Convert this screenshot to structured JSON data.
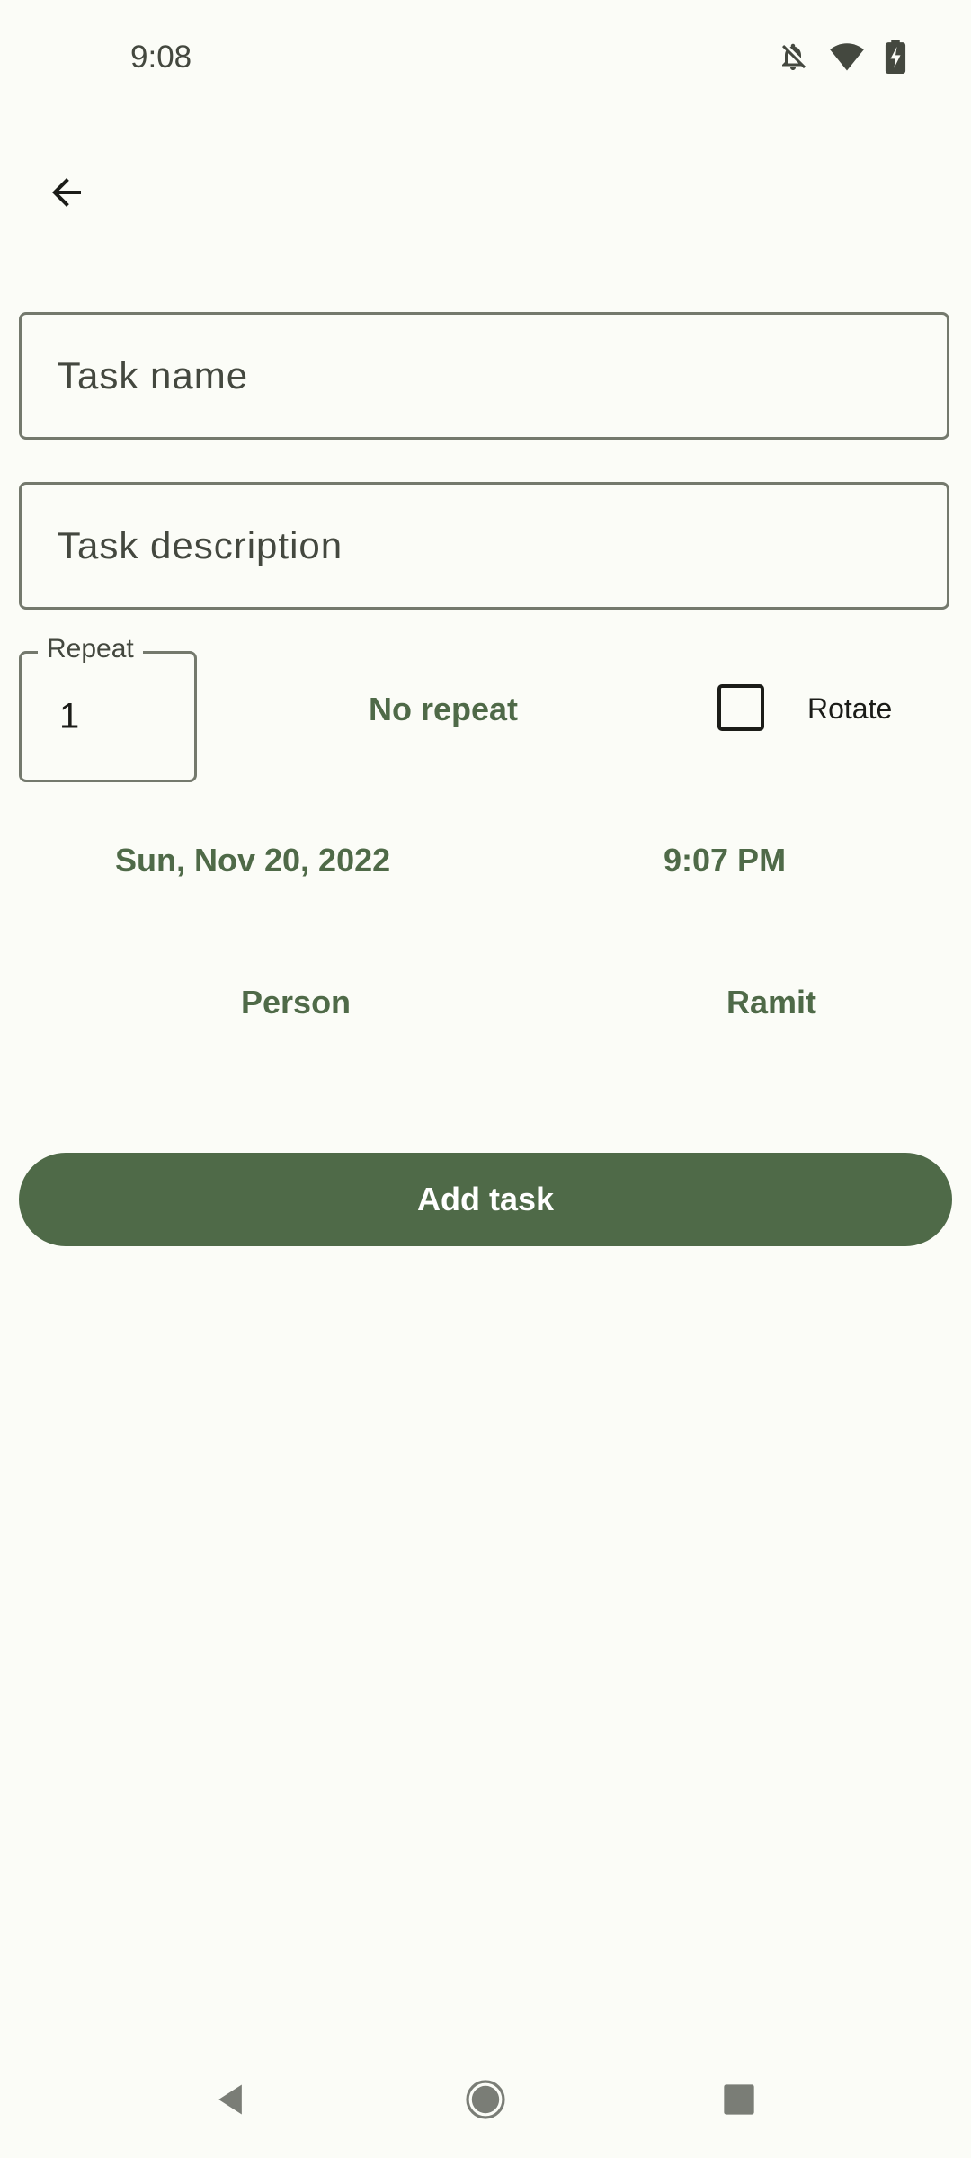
{
  "status_bar": {
    "time": "9:08",
    "icons": [
      "notifications-off-icon",
      "wifi-icon",
      "battery-charging-icon"
    ]
  },
  "header": {
    "back_icon": "arrow-back-icon"
  },
  "form": {
    "task_name_placeholder": "Task name",
    "task_description_placeholder": "Task description",
    "repeat_label": "Repeat",
    "repeat_value": "1",
    "repeat_mode": "No repeat",
    "rotate_label": "Rotate",
    "rotate_checked": false,
    "date": "Sun, Nov 20, 2022",
    "time": "9:07 PM",
    "person_label": "Person",
    "person_value": "Ramit",
    "submit_label": "Add task"
  },
  "colors": {
    "accent": "#4f6a48",
    "background": "#fbfcf7",
    "outline": "#74796d"
  },
  "nav_bar": {
    "icons": [
      "nav-back-icon",
      "nav-home-icon",
      "nav-recents-icon"
    ]
  }
}
